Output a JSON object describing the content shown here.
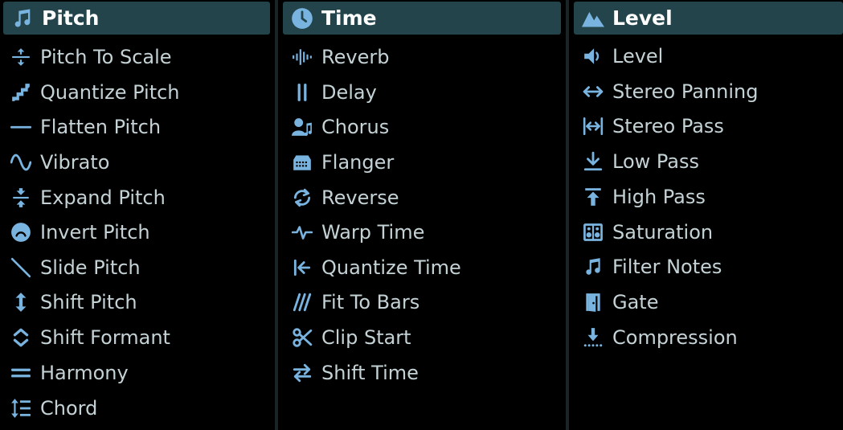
{
  "colors": {
    "header_bg": "#22444a",
    "icon": "#79b4e0",
    "text": "#c4d2d6",
    "background": "#000000"
  },
  "pitch": {
    "title": "Pitch",
    "header_icon": "music-note-icon",
    "items": [
      {
        "label": "Pitch To Scale",
        "icon": "pitch-to-scale-icon"
      },
      {
        "label": "Quantize Pitch",
        "icon": "stairs-icon"
      },
      {
        "label": "Flatten Pitch",
        "icon": "horizontal-line-icon"
      },
      {
        "label": "Vibrato",
        "icon": "wave-icon"
      },
      {
        "label": "Expand Pitch",
        "icon": "expand-vertical-icon"
      },
      {
        "label": "Invert Pitch",
        "icon": "frown-face-icon"
      },
      {
        "label": "Slide Pitch",
        "icon": "diagonal-line-icon"
      },
      {
        "label": "Shift Pitch",
        "icon": "vertical-arrows-icon"
      },
      {
        "label": "Shift Formant",
        "icon": "chevrons-up-down-icon"
      },
      {
        "label": "Harmony",
        "icon": "equals-icon"
      },
      {
        "label": "Chord",
        "icon": "line-height-icon"
      }
    ]
  },
  "time": {
    "title": "Time",
    "header_icon": "clock-icon",
    "items": [
      {
        "label": "Reverb",
        "icon": "waveform-icon"
      },
      {
        "label": "Delay",
        "icon": "pause-bars-icon"
      },
      {
        "label": "Chorus",
        "icon": "user-music-icon"
      },
      {
        "label": "Flanger",
        "icon": "keyboard-icon"
      },
      {
        "label": "Reverse",
        "icon": "repeat-icon"
      },
      {
        "label": "Warp Time",
        "icon": "heartbeat-icon"
      },
      {
        "label": "Quantize Time",
        "icon": "arrow-to-left-icon"
      },
      {
        "label": "Fit To Bars",
        "icon": "slashes-icon"
      },
      {
        "label": "Clip Start",
        "icon": "scissors-icon"
      },
      {
        "label": "Shift Time",
        "icon": "exchange-arrows-icon"
      }
    ]
  },
  "level": {
    "title": "Level",
    "header_icon": "mountains-icon",
    "items": [
      {
        "label": "Level",
        "icon": "speaker-icon"
      },
      {
        "label": "Stereo Panning",
        "icon": "left-right-arrow-icon"
      },
      {
        "label": "Stereo Pass",
        "icon": "arrows-between-bars-icon"
      },
      {
        "label": "Low Pass",
        "icon": "arrow-down-to-line-icon"
      },
      {
        "label": "High Pass",
        "icon": "arrow-up-from-line-icon"
      },
      {
        "label": "Saturation",
        "icon": "speaker-box-icon"
      },
      {
        "label": "Filter Notes",
        "icon": "music-note-icon"
      },
      {
        "label": "Gate",
        "icon": "door-open-icon"
      },
      {
        "label": "Compression",
        "icon": "download-dots-icon"
      }
    ]
  }
}
